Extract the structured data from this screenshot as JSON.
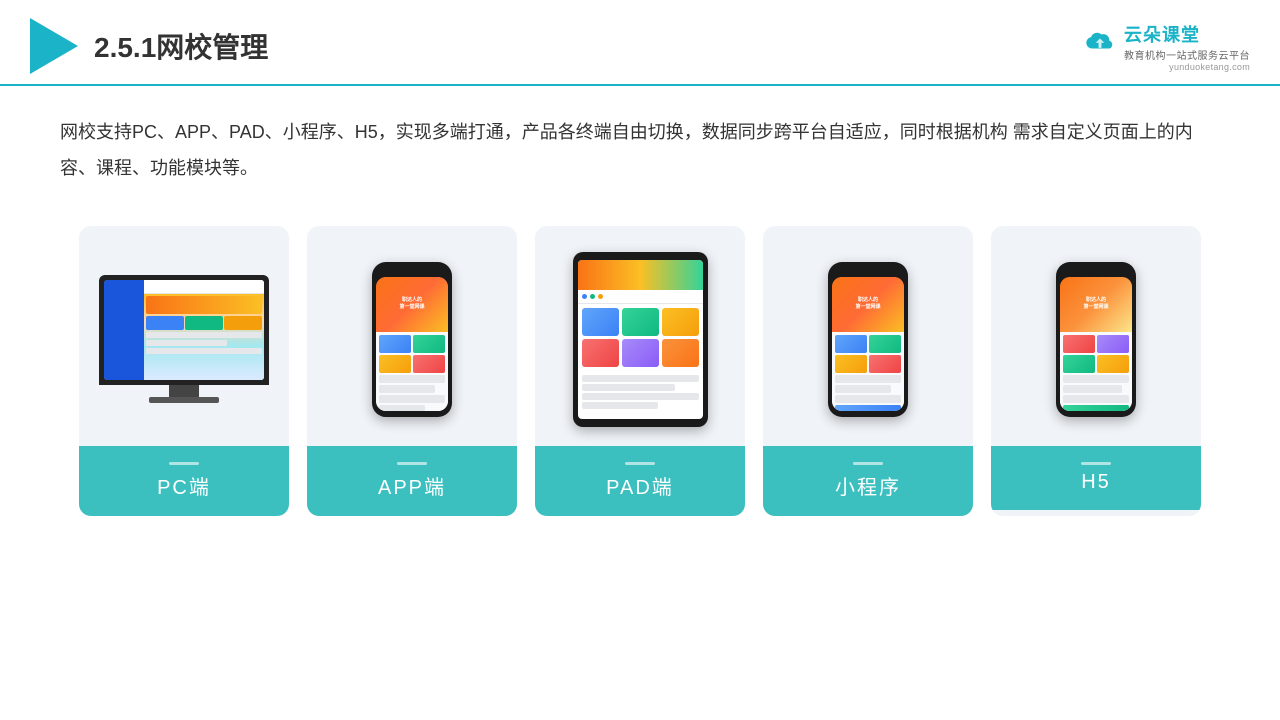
{
  "header": {
    "logo_triangle_color": "#1ab3c8",
    "page_title": "2.5.1网校管理",
    "brand": {
      "name": "云朵课堂",
      "url": "yunduoketang.com",
      "tagline": "教育机构一站\n式服务云平台"
    }
  },
  "description": "网校支持PC、APP、PAD、小程序、H5，实现多端打通，产品各终端自由切换，数据同步跨平台自适应，同时根据机构\n需求自定义页面上的内容、课程、功能模块等。",
  "cards": [
    {
      "id": "pc",
      "label": "PC端",
      "device_type": "monitor"
    },
    {
      "id": "app",
      "label": "APP端",
      "device_type": "phone"
    },
    {
      "id": "pad",
      "label": "PAD端",
      "device_type": "tablet"
    },
    {
      "id": "miniprogram",
      "label": "小程序",
      "device_type": "phone"
    },
    {
      "id": "h5",
      "label": "H5",
      "device_type": "phone"
    }
  ],
  "colors": {
    "accent": "#1ab3c8",
    "card_bg": "#f0f4f8",
    "card_label_bg": "#3cbfbf",
    "card_label_text": "#ffffff"
  }
}
